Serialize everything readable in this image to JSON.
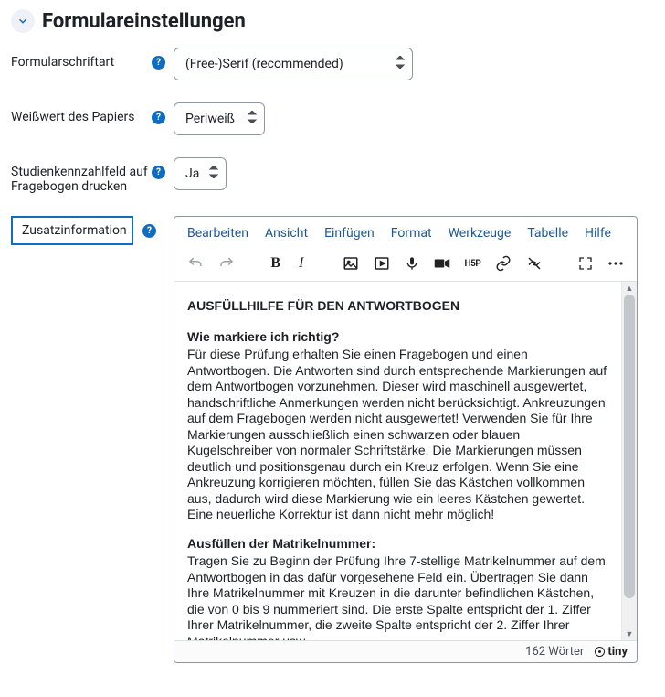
{
  "section": {
    "title": "Formulareinstellungen"
  },
  "fields": {
    "font": {
      "label": "Formularschriftart",
      "value": "(Free-)Serif (recommended)"
    },
    "whitepoint": {
      "label": "Weißwert des Papiers",
      "value": "Perlweiß"
    },
    "studycode": {
      "label": "Studienkennzahlfeld auf Fragebogen drucken",
      "value": "Ja"
    },
    "extra": {
      "label": "Zusatzinformation"
    }
  },
  "editor": {
    "menu": {
      "edit": "Bearbeiten",
      "view": "Ansicht",
      "insert": "Einfügen",
      "format": "Format",
      "tools": "Werkzeuge",
      "table": "Tabelle",
      "help": "Hilfe"
    },
    "content": {
      "h1": "AUSFÜLLHILFE FÜR DEN ANTWORTBOGEN",
      "h2a": "Wie markiere ich richtig?",
      "p1": "Für diese Prüfung erhalten Sie einen Fragebogen und einen Antwortbogen. Die Antworten sind durch entsprechende Markierungen auf dem Antwortbogen vorzunehmen. Dieser wird maschinell ausgewertet, handschriftliche Anmerkungen werden nicht berücksichtigt. Ankreuzungen auf dem Fragebogen werden nicht ausgewertet! Verwenden Sie für Ihre Markierungen ausschließlich einen schwarzen oder blauen Kugelschreiber von normaler Schriftstärke. Die Markierungen müssen deutlich und positionsgenau durch ein Kreuz erfolgen. Wenn Sie eine Ankreuzung korrigieren möchten, füllen Sie das Kästchen vollkommen aus, dadurch wird diese Markierung wie ein leeres Kästchen gewertet. Eine neuerliche Korrektur ist dann nicht mehr möglich!",
      "h2b": "Ausfüllen der Matrikelnummer:",
      "p2": "Tragen Sie zu Beginn der Prüfung Ihre 7-stellige Matrikelnummer auf dem Antwortbogen in das dafür vorgesehene Feld ein. Übertragen Sie dann Ihre Matrikelnummer mit Kreuzen in die darunter befindlichen Kästchen, die von 0 bis 9 nummeriert sind. Die erste Spalte entspricht der 1. Ziffer Ihrer Matrikelnummer, die zweite Spalte entspricht der 2. Ziffer Ihrer Matrikelnummer usw."
    },
    "status": {
      "wordcount": "162 Wörter",
      "logo": "tiny"
    }
  }
}
